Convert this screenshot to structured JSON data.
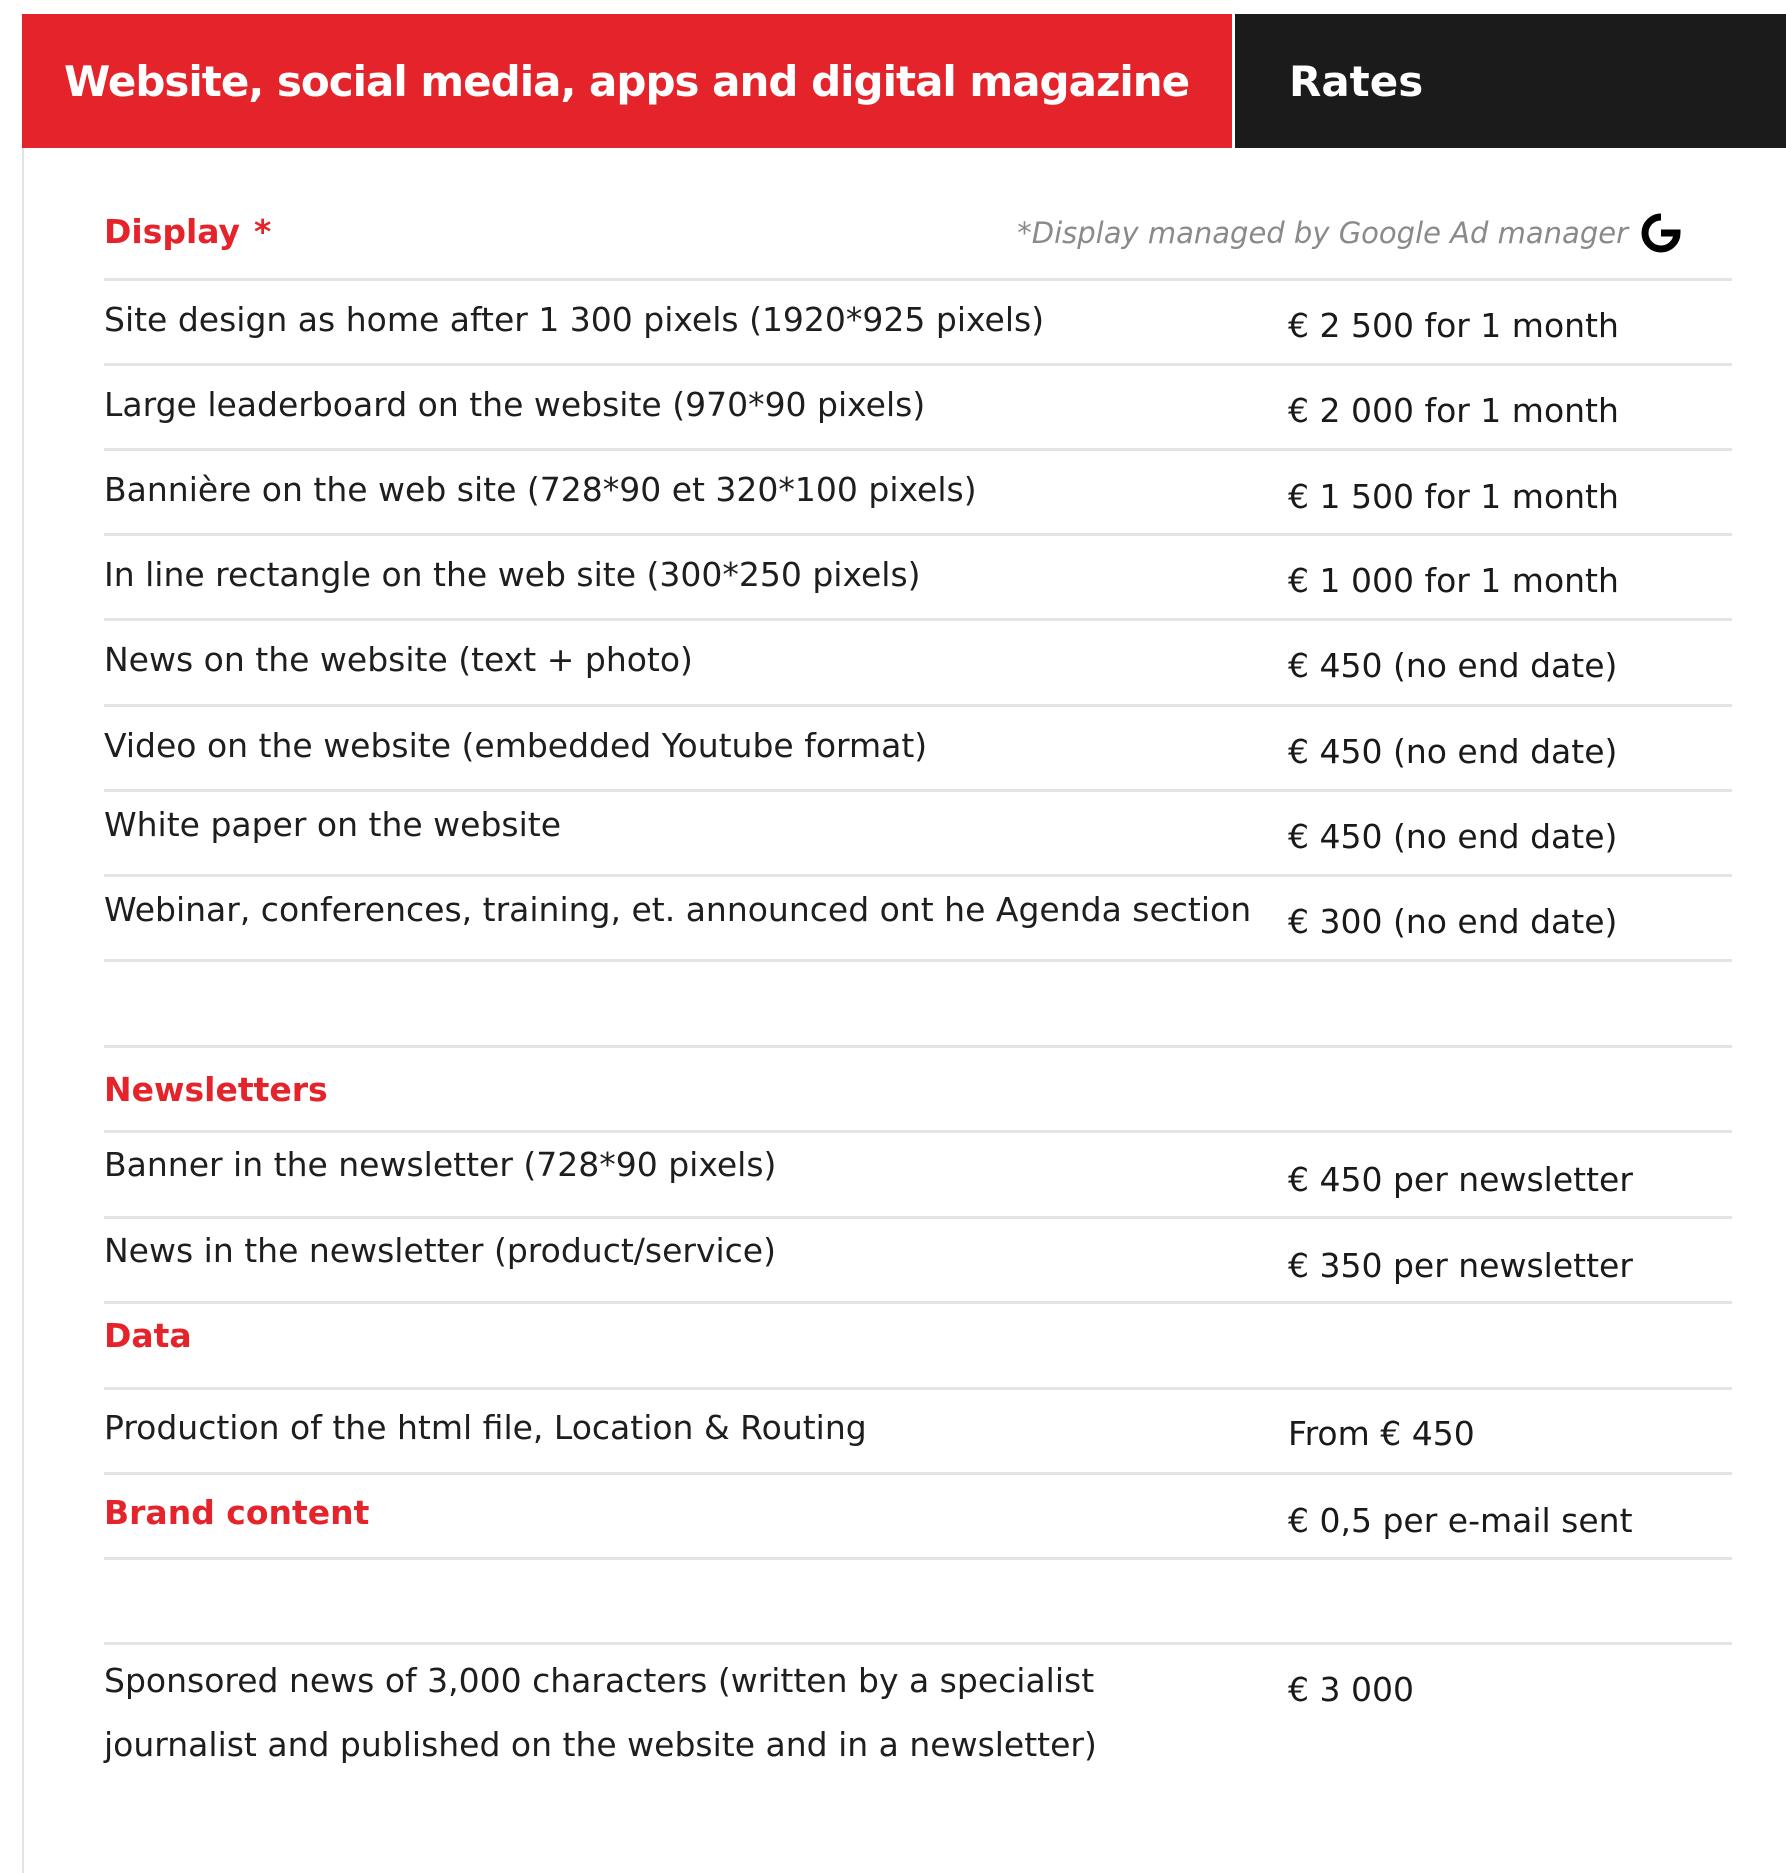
{
  "header": {
    "title": "Website, social media, apps and digital magazine",
    "rates": "Rates"
  },
  "display": {
    "title": "Display",
    "star": "*",
    "note": "*Display managed by Google Ad manager",
    "icon": "google-icon",
    "rows": [
      {
        "label": "Site design as home after 1 300 pixels (1920*925 pixels)",
        "price": "€ 2 500 for 1 month"
      },
      {
        "label": "Large leaderboard on the website  (970*90 pixels)",
        "price": "€ 2 000 for 1 month"
      },
      {
        "label": "Bannière on the web site (728*90 et 320*100 pixels)",
        "price": "€ 1  500 for 1 month"
      },
      {
        "label": "In line rectangle on the web site  (300*250 pixels)",
        "price": "€ 1 000 for 1 month"
      },
      {
        "label": "News on the website (text + photo)",
        "price": "€ 450 (no end date)"
      },
      {
        "label": "Video on the website (embedded Youtube format)",
        "price": "€ 450 (no end date)"
      },
      {
        "label": "White paper on the website",
        "price": "€ 450 (no end date)"
      },
      {
        "label": "Webinar, conferences, training, et. announced ont he Agenda section",
        "price": "€ 300 (no end date)"
      }
    ]
  },
  "newsletters": {
    "title": "Newsletters",
    "rows": [
      {
        "label": "Banner in the newsletter (728*90 pixels)",
        "price": "€ 450 per newsletter"
      },
      {
        "label": "News in the newsletter (product/service)",
        "price": "€ 350  per newsletter"
      }
    ]
  },
  "data_section": {
    "title": "Data",
    "rows": [
      {
        "label": "Production of the html file, Location & Routing",
        "price": "From € 450"
      }
    ]
  },
  "brand_content": {
    "title": "Brand content",
    "price": "€ 0,5 per e-mail sent",
    "sponsored": {
      "label": "Sponsored news of 3,000 characters (written by a specialist journalist and published on the website and in a newsletter)",
      "price": "€ 3 000"
    }
  },
  "colors": {
    "accent": "#e5232b",
    "dark": "#1b1b1b",
    "rule": "#e4e4e4"
  }
}
